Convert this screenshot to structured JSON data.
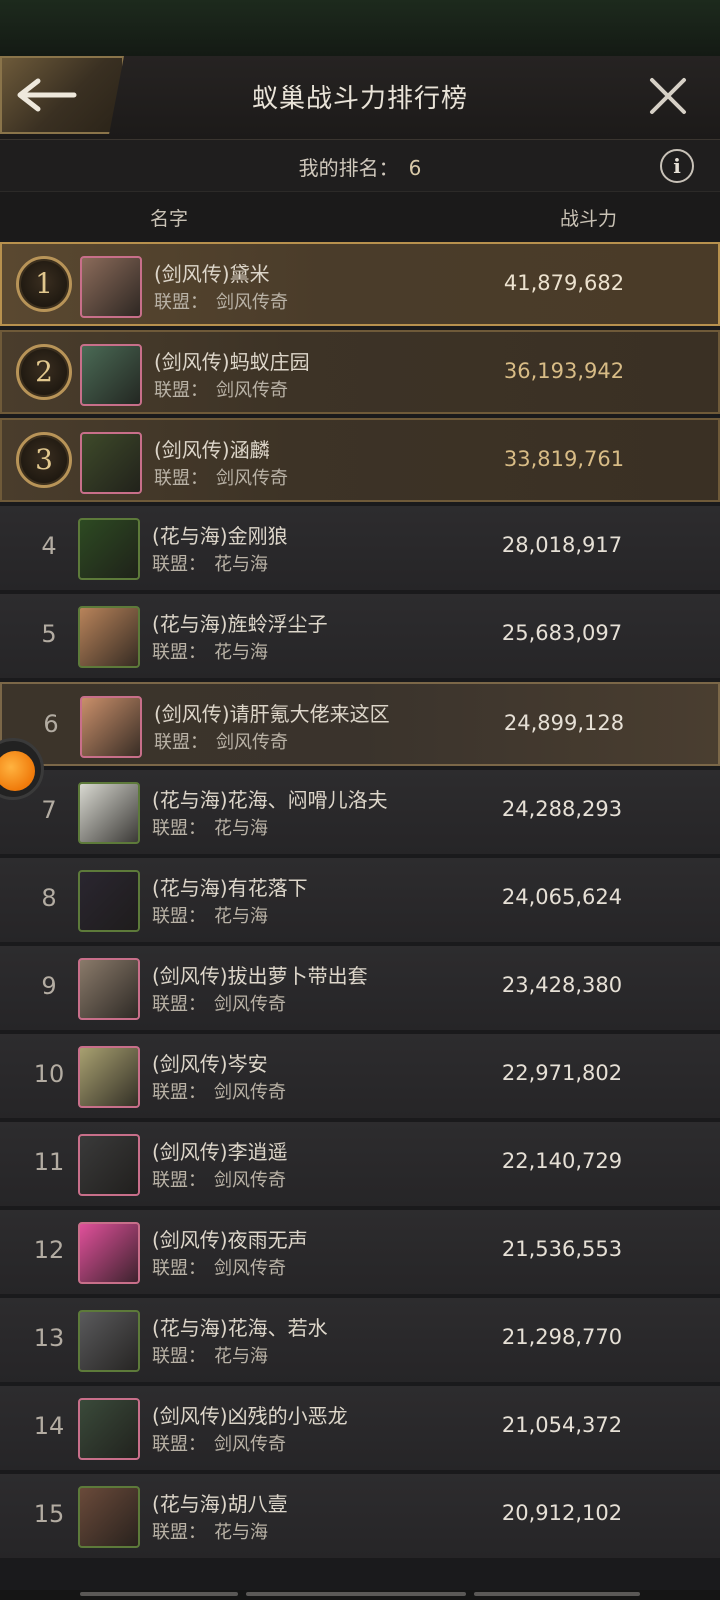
{
  "header": {
    "title": "蚁巢战斗力排行榜"
  },
  "my_rank": {
    "label": "我的排名：",
    "value": "6"
  },
  "columns": {
    "name": "名字",
    "power": "战斗力"
  },
  "alliance_label": "联盟：",
  "rows": [
    {
      "rank": "1",
      "name": "(剑风传)黛米",
      "alliance": "剑风传奇",
      "power": "41,879,682",
      "avatar": "ant-hatchery-avatar",
      "avatar_color": "#8b6b5a"
    },
    {
      "rank": "2",
      "name": "(剑风传)蚂蚁庄园",
      "alliance": "剑风传奇",
      "power": "36,193,942",
      "avatar": "people-photo-avatar",
      "avatar_color": "#4a6a55"
    },
    {
      "rank": "3",
      "name": "(剑风传)涵麟",
      "alliance": "剑风传奇",
      "power": "33,819,761",
      "avatar": "ant-warrior-avatar",
      "avatar_color": "#3e4a2a"
    },
    {
      "rank": "4",
      "name": "(花与海)金刚狼",
      "alliance": "花与海",
      "power": "28,018,917",
      "avatar": "black-ant-avatar",
      "avatar_color": "#2d4a22"
    },
    {
      "rank": "5",
      "name": "(花与海)旌蛉浮尘子",
      "alliance": "花与海",
      "power": "25,683,097",
      "avatar": "shiba-dog-avatar",
      "avatar_color": "#b8835a"
    },
    {
      "rank": "6",
      "name": "(剑风传)请肝氪大佬来这区",
      "alliance": "剑风传奇",
      "power": "24,899,128",
      "avatar": "anime-girl-avatar",
      "avatar_color": "#c98f6a"
    },
    {
      "rank": "7",
      "name": "(花与海)花海、闷嗗儿洛夫",
      "alliance": "花与海",
      "power": "24,288,293",
      "avatar": "panda-avatar",
      "avatar_color": "#d8d8d0"
    },
    {
      "rank": "8",
      "name": "(花与海)有花落下",
      "alliance": "花与海",
      "power": "24,065,624",
      "avatar": "night-tree-avatar",
      "avatar_color": "#2a2630"
    },
    {
      "rank": "9",
      "name": "(剑风传)拔出萝卜带出套",
      "alliance": "剑风传奇",
      "power": "23,428,380",
      "avatar": "pale-figures-avatar",
      "avatar_color": "#8a7a6a"
    },
    {
      "rank": "10",
      "name": "(剑风传)岑安",
      "alliance": "剑风传奇",
      "power": "22,971,802",
      "avatar": "flower-vase-avatar",
      "avatar_color": "#a8a070"
    },
    {
      "rank": "11",
      "name": "(剑风传)李逍遥",
      "alliance": "剑风传奇",
      "power": "22,140,729",
      "avatar": "man-in-cap-avatar",
      "avatar_color": "#3a3a3a"
    },
    {
      "rank": "12",
      "name": "(剑风传)夜雨无声",
      "alliance": "剑风传奇",
      "power": "21,536,553",
      "avatar": "pink-cartoon-avatar",
      "avatar_color": "#e0509a"
    },
    {
      "rank": "13",
      "name": "(花与海)花海、若水",
      "alliance": "花与海",
      "power": "21,298,770",
      "avatar": "sketch-girl-avatar",
      "avatar_color": "#5a5a5c"
    },
    {
      "rank": "14",
      "name": "(剑风传)凶残的小恶龙",
      "alliance": "剑风传奇",
      "power": "21,054,372",
      "avatar": "anime-chibi-avatar",
      "avatar_color": "#3a4a3a"
    },
    {
      "rank": "15",
      "name": "(花与海)胡八壹",
      "alliance": "花与海",
      "power": "20,912,102",
      "avatar": "brown-figure-avatar",
      "avatar_color": "#6a4a3a"
    }
  ]
}
